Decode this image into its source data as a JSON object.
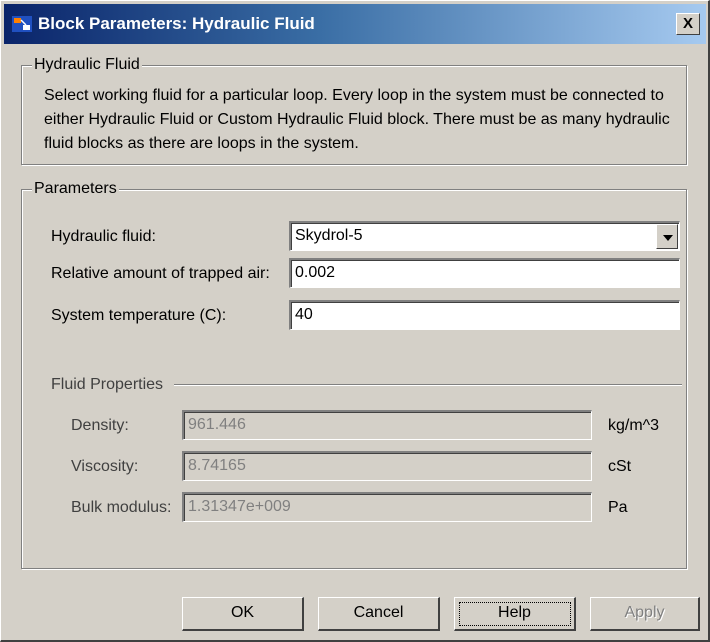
{
  "window": {
    "title": "Block Parameters: Hydraulic Fluid",
    "close_label": "X"
  },
  "description_group": {
    "label": "Hydraulic Fluid",
    "text": "Select working fluid for a particular loop. Every loop in the system must be connected to either Hydraulic Fluid or Custom Hydraulic Fluid block. There must be as many hydraulic fluid blocks as there are loops in the system."
  },
  "parameters_group": {
    "label": "Parameters",
    "hydraulic_fluid": {
      "label": "Hydraulic fluid:",
      "value": "Skydrol-5"
    },
    "trapped_air": {
      "label": "Relative amount of trapped air:",
      "value": "0.002"
    },
    "system_temperature": {
      "label": "System temperature (C):",
      "value": "40"
    }
  },
  "fluid_properties": {
    "label": "Fluid Properties",
    "density": {
      "label": "Density:",
      "value": "961.446",
      "unit": "kg/m^3"
    },
    "viscosity": {
      "label": "Viscosity:",
      "value": "8.74165",
      "unit": "cSt"
    },
    "bulk_modulus": {
      "label": "Bulk modulus:",
      "value": "1.31347e+009",
      "unit": "Pa"
    }
  },
  "buttons": {
    "ok": "OK",
    "cancel": "Cancel",
    "help": "Help",
    "apply": "Apply"
  },
  "colors": {
    "title_bar_start": "#0a246a",
    "title_bar_end": "#a6caf0",
    "dialog_background": "#d4d0c8"
  },
  "icons": {
    "title": "simulink-block-icon",
    "dropdown": "chevron-down-icon"
  }
}
